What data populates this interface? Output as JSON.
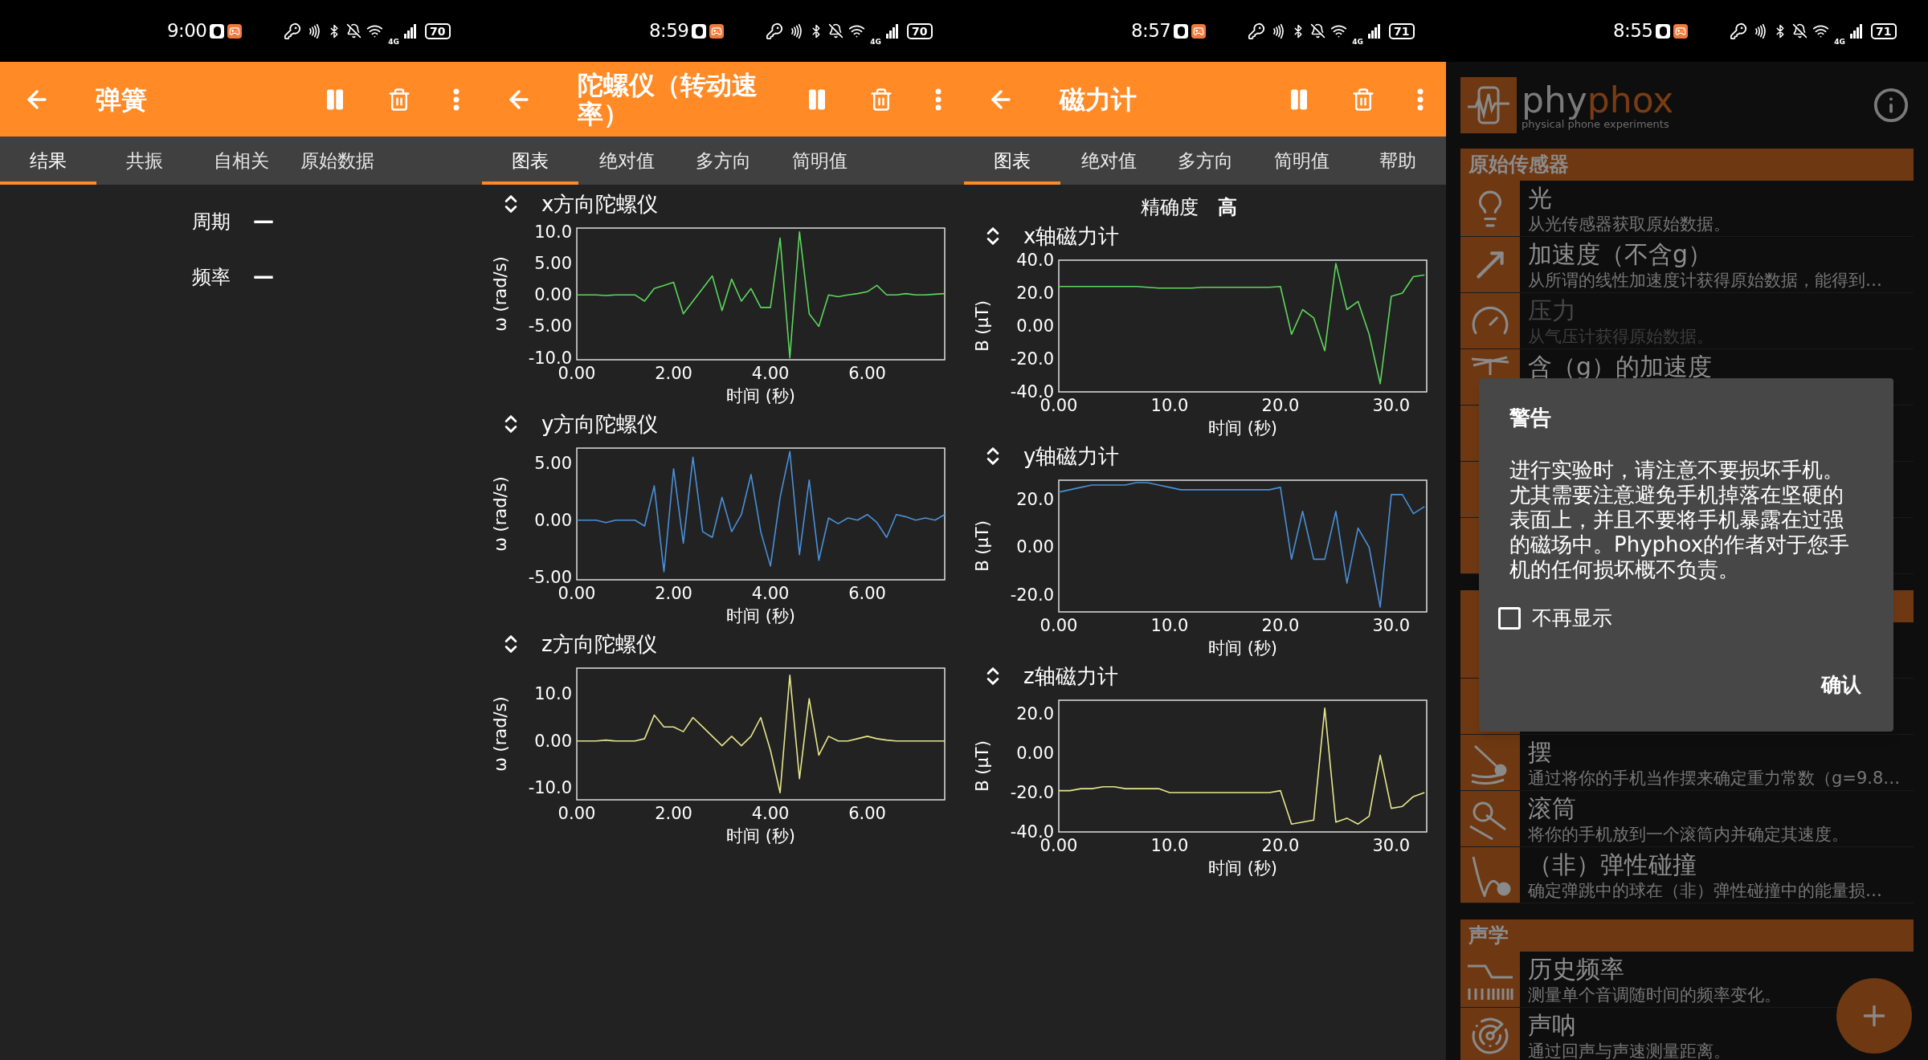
{
  "screens": [
    {
      "kind": "results",
      "status_bar": {
        "time": "9:00",
        "network": "4G",
        "battery": "70"
      },
      "toolbar": {
        "title": "弹簧"
      },
      "tabs": [
        {
          "label": "结果",
          "selected": true
        },
        {
          "label": "共振",
          "selected": false
        },
        {
          "label": "自相关",
          "selected": false
        },
        {
          "label": "原始数据",
          "selected": false
        }
      ],
      "results": [
        {
          "label": "周期",
          "value": "—"
        },
        {
          "label": "频率",
          "value": "—"
        }
      ]
    },
    {
      "kind": "charts",
      "status_bar": {
        "time": "8:59",
        "network": "4G",
        "battery": "70"
      },
      "toolbar": {
        "title": "陀螺仪（转动速率）"
      },
      "tabs": [
        {
          "label": "图表",
          "selected": true
        },
        {
          "label": "绝对值",
          "selected": false
        },
        {
          "label": "多方向",
          "selected": false
        },
        {
          "label": "简明值",
          "selected": false
        }
      ],
      "charts": [
        {
          "chart_data": {
            "type": "line",
            "title": "x方向陀螺仪",
            "xlabel": "时间 (秒)",
            "ylabel": "ω (rad/s)",
            "x": [
              0,
              0.2,
              0.4,
              0.6,
              0.8,
              1,
              1.2,
              1.4,
              1.6,
              1.8,
              2,
              2.2,
              2.4,
              2.6,
              2.8,
              3,
              3.2,
              3.4,
              3.6,
              3.8,
              4,
              4.2,
              4.4,
              4.6,
              4.8,
              5,
              5.2,
              5.4,
              5.6,
              5.8,
              6,
              6.2,
              6.4,
              6.6,
              6.8,
              7,
              7.2,
              7.4,
              7.6
            ],
            "xlim": [
              0,
              7.6
            ],
            "ylim": [
              -10.3,
              10.6
            ],
            "series": [
              {
                "color": "#5cd65c",
                "values": [
                  0,
                  0,
                  0,
                  -0.1,
                  0,
                  0,
                  0,
                  -1,
                  1,
                  1.5,
                  2,
                  -3,
                  -1,
                  1,
                  3,
                  -2.5,
                  2.5,
                  -1,
                  1,
                  -2,
                  -2,
                  9,
                  -10,
                  10,
                  -3,
                  -5,
                  0,
                  -0.3,
                  0,
                  0.2,
                  0.5,
                  1.5,
                  0,
                  0,
                  0.2,
                  0,
                  0,
                  0.1,
                  0.2
                ]
              }
            ],
            "xticks": [
              {
                "value": 0,
                "label": "0.00"
              },
              {
                "value": 2,
                "label": "2.00"
              },
              {
                "value": 4,
                "label": "4.00"
              },
              {
                "value": 6,
                "label": "6.00"
              }
            ],
            "yticks": [
              {
                "value": -10,
                "label": "-10.0"
              },
              {
                "value": -5,
                "label": "-5.00"
              },
              {
                "value": 0,
                "label": "0.00"
              },
              {
                "value": 5,
                "label": "5.00"
              },
              {
                "value": 10,
                "label": "10.0"
              }
            ]
          }
        },
        {
          "chart_data": {
            "type": "line",
            "title": "y方向陀螺仪",
            "xlabel": "时间 (秒)",
            "ylabel": "ω (rad/s)",
            "x": [
              0,
              0.2,
              0.4,
              0.6,
              0.8,
              1,
              1.2,
              1.4,
              1.6,
              1.8,
              2,
              2.2,
              2.4,
              2.6,
              2.8,
              3,
              3.2,
              3.4,
              3.6,
              3.8,
              4,
              4.2,
              4.4,
              4.6,
              4.8,
              5,
              5.2,
              5.4,
              5.6,
              5.8,
              6,
              6.2,
              6.4,
              6.6,
              6.8,
              7,
              7.2,
              7.4,
              7.6
            ],
            "xlim": [
              0,
              7.6
            ],
            "ylim": [
              -5.2,
              6.3
            ],
            "series": [
              {
                "color": "#4a90d9",
                "values": [
                  0,
                  0,
                  0,
                  -0.2,
                  0,
                  0,
                  0,
                  -0.5,
                  3,
                  -4.5,
                  4.5,
                  -2,
                  5.5,
                  -1,
                  -1.5,
                  2,
                  -1,
                  0.5,
                  4,
                  -1,
                  -4,
                  2,
                  6,
                  -3,
                  3.5,
                  -3.5,
                  0.2,
                  -0.3,
                  0.2,
                  0,
                  0.5,
                  -0.2,
                  -1.5,
                  0.5,
                  0.3,
                  0,
                  0.2,
                  0,
                  0.5
                ]
              }
            ],
            "xticks": [
              {
                "value": 0,
                "label": "0.00"
              },
              {
                "value": 2,
                "label": "2.00"
              },
              {
                "value": 4,
                "label": "4.00"
              },
              {
                "value": 6,
                "label": "6.00"
              }
            ],
            "yticks": [
              {
                "value": -5,
                "label": "-5.00"
              },
              {
                "value": 0,
                "label": "0.00"
              },
              {
                "value": 5,
                "label": "5.00"
              }
            ]
          }
        },
        {
          "chart_data": {
            "type": "line",
            "title": "z方向陀螺仪",
            "xlabel": "时间 (秒)",
            "ylabel": "ω (rad/s)",
            "x": [
              0,
              0.2,
              0.4,
              0.6,
              0.8,
              1,
              1.2,
              1.4,
              1.6,
              1.8,
              2,
              2.2,
              2.4,
              2.6,
              2.8,
              3,
              3.2,
              3.4,
              3.6,
              3.8,
              4,
              4.2,
              4.4,
              4.6,
              4.8,
              5,
              5.2,
              5.4,
              5.6,
              5.8,
              6,
              6.2,
              6.4,
              6.6,
              6.8,
              7,
              7.2,
              7.4,
              7.6
            ],
            "xlim": [
              0,
              7.6
            ],
            "ylim": [
              -12.5,
              15.5
            ],
            "series": [
              {
                "color": "#e6e68c",
                "values": [
                  0,
                  0,
                  0,
                  0.2,
                  0,
                  0,
                  0,
                  0.5,
                  5.5,
                  3,
                  3,
                  2,
                  5,
                  3,
                  1,
                  -1,
                  1,
                  -1,
                  1,
                  5,
                  -2,
                  -11,
                  14,
                  -8,
                  9,
                  -3,
                  1,
                  0,
                  0,
                  0.5,
                  1,
                  0.5,
                  0.2,
                  0,
                  0,
                  0,
                  0,
                  0,
                  0
                ]
              }
            ],
            "xticks": [
              {
                "value": 0,
                "label": "0.00"
              },
              {
                "value": 2,
                "label": "2.00"
              },
              {
                "value": 4,
                "label": "4.00"
              },
              {
                "value": 6,
                "label": "6.00"
              }
            ],
            "yticks": [
              {
                "value": -10,
                "label": "-10.0"
              },
              {
                "value": 0,
                "label": "0.00"
              },
              {
                "value": 10,
                "label": "10.0"
              }
            ]
          }
        }
      ]
    },
    {
      "kind": "charts",
      "status_bar": {
        "time": "8:57",
        "network": "4G",
        "battery": "71"
      },
      "toolbar": {
        "title": "磁力计"
      },
      "tabs": [
        {
          "label": "图表",
          "selected": true
        },
        {
          "label": "绝对值",
          "selected": false
        },
        {
          "label": "多方向",
          "selected": false
        },
        {
          "label": "简明值",
          "selected": false
        },
        {
          "label": "帮助",
          "selected": false
        }
      ],
      "accuracy": {
        "label": "精确度",
        "value": "高"
      },
      "charts": [
        {
          "chart_data": {
            "type": "line",
            "title": "x轴磁力计",
            "xlabel": "时间 (秒)",
            "ylabel": "B (µT)",
            "x": [
              0,
              1,
              2,
              3,
              4,
              5,
              6,
              7,
              8,
              9,
              10,
              11,
              12,
              13,
              14,
              15,
              16,
              17,
              18,
              19,
              20,
              21,
              22,
              23,
              24,
              25,
              26,
              27,
              28,
              29,
              30,
              31,
              32,
              33
            ],
            "xlim": [
              0,
              33.2
            ],
            "ylim": [
              -40,
              40
            ],
            "series": [
              {
                "color": "#5cd65c",
                "values": [
                  24,
                  24,
                  24,
                  24,
                  24,
                  24,
                  24,
                  24,
                  23.5,
                  23,
                  23,
                  23,
                  23,
                  23.5,
                  23.5,
                  23.5,
                  23.5,
                  23.5,
                  23.5,
                  23.5,
                  24,
                  -5,
                  10,
                  5,
                  -15,
                  38,
                  10,
                  15,
                  -5,
                  -35,
                  18,
                  20,
                  30,
                  31
                ]
              }
            ],
            "xticks": [
              {
                "value": 0,
                "label": "0.00"
              },
              {
                "value": 10,
                "label": "10.0"
              },
              {
                "value": 20,
                "label": "20.0"
              },
              {
                "value": 30,
                "label": "30.0"
              }
            ],
            "yticks": [
              {
                "value": -40,
                "label": "-40.0"
              },
              {
                "value": -20,
                "label": "-20.0"
              },
              {
                "value": 0,
                "label": "0.00"
              },
              {
                "value": 20,
                "label": "20.0"
              },
              {
                "value": 40,
                "label": "40.0"
              }
            ]
          }
        },
        {
          "chart_data": {
            "type": "line",
            "title": "y轴磁力计",
            "xlabel": "时间 (秒)",
            "ylabel": "B (µT)",
            "x": [
              0,
              1,
              2,
              3,
              4,
              5,
              6,
              7,
              8,
              9,
              10,
              11,
              12,
              13,
              14,
              15,
              16,
              17,
              18,
              19,
              20,
              21,
              22,
              23,
              24,
              25,
              26,
              27,
              28,
              29,
              30,
              31,
              32,
              33
            ],
            "xlim": [
              0,
              33.2
            ],
            "ylim": [
              -27,
              28
            ],
            "series": [
              {
                "color": "#4a90d9",
                "values": [
                  23,
                  24,
                  25,
                  26,
                  26,
                  26,
                  26,
                  27,
                  27,
                  26,
                  25,
                  24,
                  24,
                  24,
                  24,
                  24,
                  24,
                  24,
                  24,
                  24,
                  25,
                  -5,
                  15,
                  -5,
                  -5,
                  15,
                  -15,
                  8,
                  0,
                  -25,
                  22,
                  22,
                  14,
                  17
                ]
              }
            ],
            "xticks": [
              {
                "value": 0,
                "label": "0.00"
              },
              {
                "value": 10,
                "label": "10.0"
              },
              {
                "value": 20,
                "label": "20.0"
              },
              {
                "value": 30,
                "label": "30.0"
              }
            ],
            "yticks": [
              {
                "value": -20,
                "label": "-20.0"
              },
              {
                "value": 0,
                "label": "0.00"
              },
              {
                "value": 20,
                "label": "20.0"
              }
            ]
          }
        },
        {
          "chart_data": {
            "type": "line",
            "title": "z轴磁力计",
            "xlabel": "时间 (秒)",
            "ylabel": "B (µT)",
            "x": [
              0,
              1,
              2,
              3,
              4,
              5,
              6,
              7,
              8,
              9,
              10,
              11,
              12,
              13,
              14,
              15,
              16,
              17,
              18,
              19,
              20,
              21,
              22,
              23,
              24,
              25,
              26,
              27,
              28,
              29,
              30,
              31,
              32,
              33
            ],
            "xlim": [
              0,
              33.2
            ],
            "ylim": [
              -40,
              27
            ],
            "series": [
              {
                "color": "#e6e68c",
                "values": [
                  -19,
                  -19,
                  -18,
                  -18,
                  -17,
                  -17,
                  -18,
                  -18,
                  -18,
                  -18,
                  -20,
                  -20,
                  -20,
                  -20,
                  -20,
                  -20,
                  -20,
                  -20,
                  -20,
                  -20,
                  -19,
                  -36,
                  -35,
                  -34,
                  23,
                  -35,
                  -33,
                  -36,
                  -32,
                  -1,
                  -28,
                  -27,
                  -22,
                  -20
                ]
              }
            ],
            "xticks": [
              {
                "value": 0,
                "label": "0.00"
              },
              {
                "value": 10,
                "label": "10.0"
              },
              {
                "value": 20,
                "label": "20.0"
              },
              {
                "value": 30,
                "label": "30.0"
              }
            ],
            "yticks": [
              {
                "value": -40,
                "label": "-40.0"
              },
              {
                "value": -20,
                "label": "-20.0"
              },
              {
                "value": 0,
                "label": "0.00"
              },
              {
                "value": 20,
                "label": "20.0"
              }
            ]
          }
        }
      ]
    },
    {
      "kind": "menu",
      "status_bar": {
        "time": "8:55",
        "network": "4G",
        "battery": "71"
      },
      "logo": {
        "name_start": "phy",
        "name_end": "phox",
        "tagline": "physical phone experiments"
      },
      "sections": [
        {
          "title": "原始传感器",
          "items": [
            {
              "title": "光",
              "description": "从光传感器获取原始数据。",
              "disabled": false
            },
            {
              "title": "加速度（不含g）",
              "description": "从所谓的线性加速度计获得原始数据，能得到…",
              "disabled": false
            },
            {
              "title": "压力",
              "description": "从气压计获得原始数据。",
              "disabled": true
            },
            {
              "title": "含（g）的加速度",
              "disabled": false
            }
          ]
        },
        {
          "items": [
            {
              "title": "摆",
              "description": "通过将你的手机当作摆来确定重力常数（g=9.8…",
              "disabled": false
            },
            {
              "title": "滚筒",
              "description": "将你的手机放到一个滚筒内并确定其速度。",
              "disabled": false
            },
            {
              "title": "（非）弹性碰撞",
              "description": "确定弹跳中的球在（非）弹性碰撞中的能量损…",
              "disabled": false
            }
          ]
        },
        {
          "title": "声学",
          "items": [
            {
              "title": "历史频率",
              "description": "测量单个音调随时间的频率变化。",
              "disabled": false
            },
            {
              "title": "声呐",
              "description": "通过回声与声速测量距离。",
              "disabled": false
            }
          ]
        }
      ],
      "dialog": {
        "title": "警告",
        "message": "进行实验时，请注意不要损坏手机。尤其需要注意避免手机掉落在坚硬的表面上，并且不要将手机暴露在过强的磁场中。Phyphox的作者对于您手机的任何损坏概不负责。",
        "checkbox": {
          "label": "不再显示",
          "checked": false
        },
        "button": "确认"
      }
    }
  ]
}
